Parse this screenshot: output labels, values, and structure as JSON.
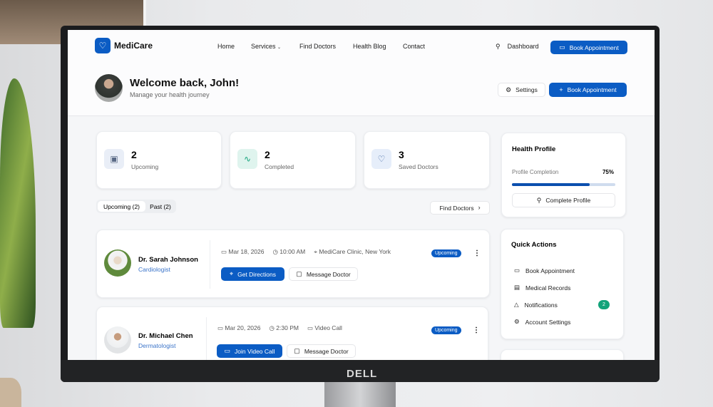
{
  "brand": "MediCare",
  "nav": {
    "items": [
      "Home",
      "Services",
      "Find Doctors",
      "Health Blog",
      "Contact"
    ],
    "dashboard": "Dashboard",
    "book": "Book Appointment"
  },
  "header": {
    "title": "Welcome back, John!",
    "subtitle": "Manage your health journey",
    "settings": "Settings",
    "book": "Book Appointment"
  },
  "stats": [
    {
      "value": "2",
      "label": "Upcoming"
    },
    {
      "value": "2",
      "label": "Completed"
    },
    {
      "value": "3",
      "label": "Saved Doctors"
    }
  ],
  "tabs": {
    "upcoming": "Upcoming (2)",
    "past": "Past (2)",
    "find": "Find Doctors"
  },
  "appointments": [
    {
      "name": "Dr. Sarah Johnson",
      "specialty": "Cardiologist",
      "date": "Mar 18, 2026",
      "time": "10:00 AM",
      "location": "MediCare Clinic, New York",
      "status": "Upcoming",
      "primary": "Get Directions",
      "secondary": "Message Doctor"
    },
    {
      "name": "Dr. Michael Chen",
      "specialty": "Dermatologist",
      "date": "Mar 20, 2026",
      "time": "2:30 PM",
      "location": "Video Call",
      "status": "Upcoming",
      "primary": "Join Video Call",
      "secondary": "Message Doctor"
    }
  ],
  "profile": {
    "title": "Health Profile",
    "label": "Profile Completion",
    "percent": "75%",
    "progress": 0.75,
    "button": "Complete Profile"
  },
  "quick": {
    "title": "Quick Actions",
    "items": [
      "Book Appointment",
      "Medical Records",
      "Notifications",
      "Account Settings"
    ],
    "notif_count": "2"
  },
  "monitor_brand": "DELL",
  "colors": {
    "primary": "#0b5cc4",
    "success": "#12a37a"
  }
}
